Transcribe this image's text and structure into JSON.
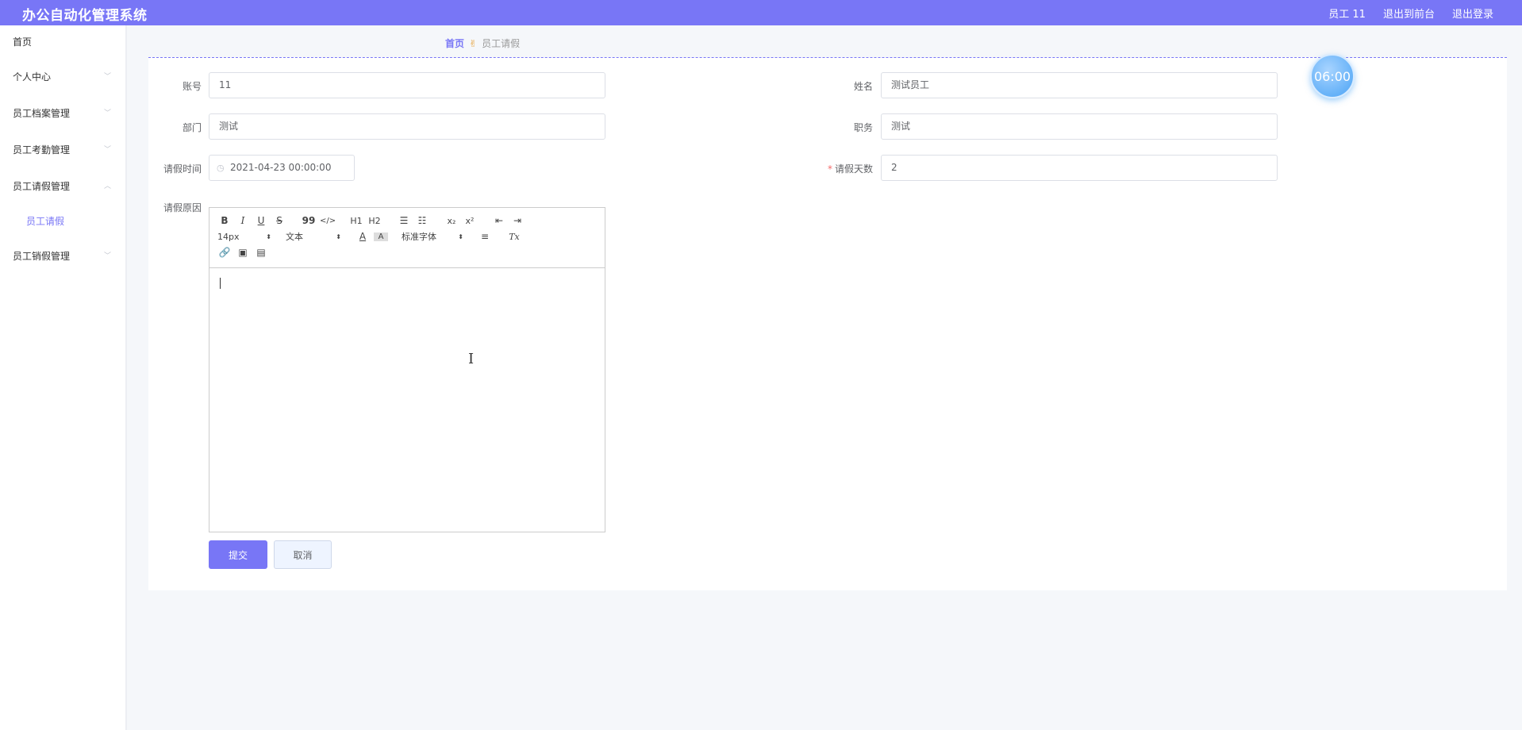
{
  "header": {
    "app_title": "办公自动化管理系统",
    "user_label": "员工 11",
    "to_front_label": "退出到前台",
    "logout_label": "退出登录"
  },
  "sidebar": {
    "items": [
      {
        "label": "首页"
      },
      {
        "label": "个人中心"
      },
      {
        "label": "员工档案管理"
      },
      {
        "label": "员工考勤管理"
      },
      {
        "label": "员工请假管理"
      },
      {
        "label": "员工请假"
      },
      {
        "label": "员工销假管理"
      }
    ]
  },
  "breadcrumb": {
    "home": "首页",
    "current": "员工请假"
  },
  "timer": "06:00",
  "form": {
    "account_label": "账号",
    "account_value": "11",
    "name_label": "姓名",
    "name_value": "测试员工",
    "dept_label": "部门",
    "dept_value": "测试",
    "position_label": "职务",
    "position_value": "测试",
    "leave_time_label": "请假时间",
    "leave_time_value": "2021-04-23 00:00:00",
    "leave_days_label": "请假天数",
    "leave_days_value": "2",
    "required_mark": "*",
    "reason_label": "请假原因"
  },
  "editor_toolbar": {
    "bold": "B",
    "italic": "I",
    "underline": "U",
    "strike": "S",
    "blockquote": "99",
    "code": "</>",
    "h1": "H1",
    "h2": "H2",
    "subscript": "x₂",
    "superscript": "x²",
    "font_size": "14px",
    "header_select": "文本",
    "font_family": "标准字体",
    "clean": "Tx"
  },
  "buttons": {
    "submit": "提交",
    "cancel": "取消"
  }
}
